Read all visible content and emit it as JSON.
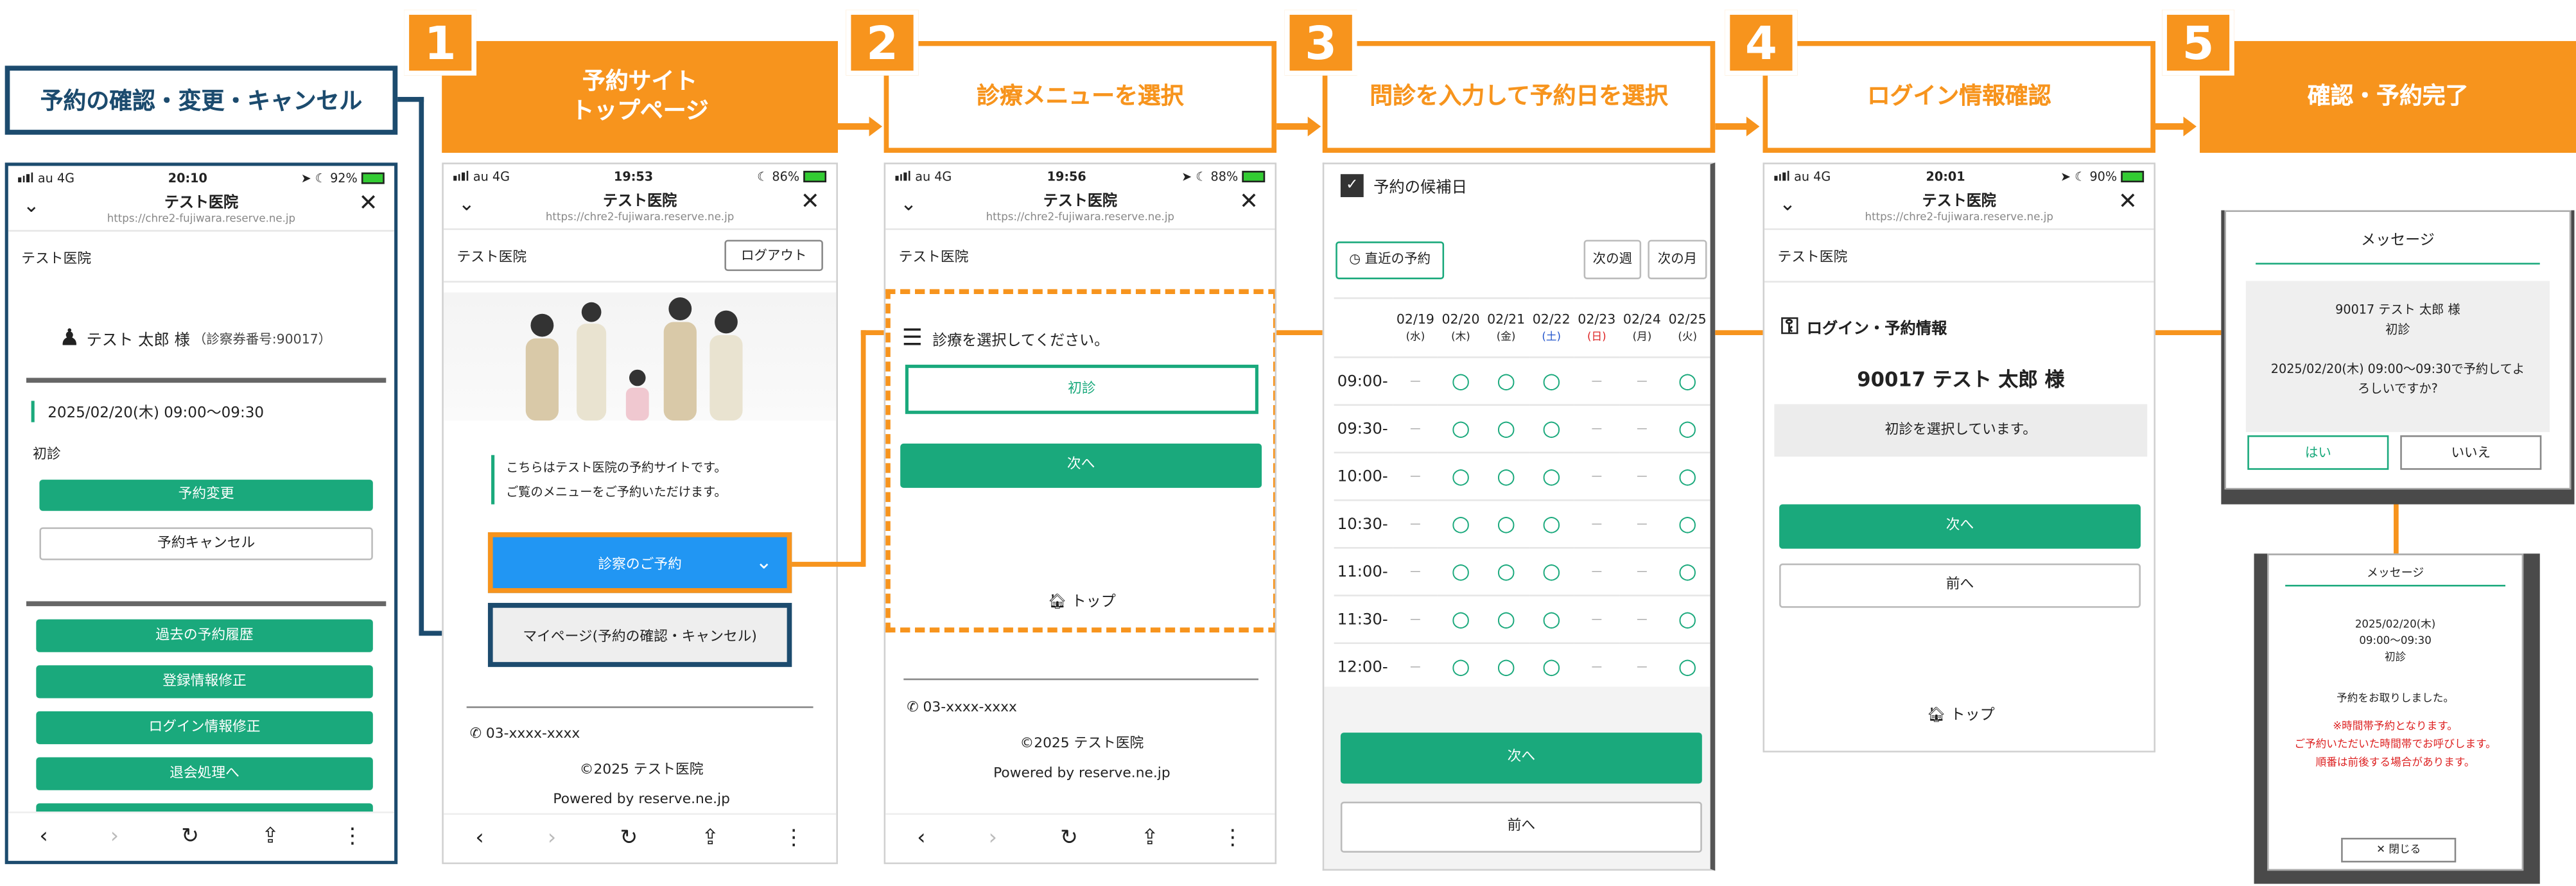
{
  "left_label": "予約の確認・変更・キャンセル",
  "steps": [
    {
      "num": "1",
      "title_line1": "予約サイト",
      "title_line2": "トップページ"
    },
    {
      "num": "2",
      "title": "診療メニューを選択"
    },
    {
      "num": "3",
      "title": "問診を入力して予約日を選択"
    },
    {
      "num": "4",
      "title": "ログイン情報確認"
    },
    {
      "num": "5",
      "title": "確認・予約完了"
    }
  ],
  "common": {
    "carrier": "au  4G",
    "site_title": "テスト医院",
    "url": "https://chre2-fujiwara.reserve.ne.jp",
    "hospital": "テスト医院",
    "phone": "03-xxxx-xxxx",
    "copyright": "©2025 テスト医院",
    "powered": "Powered by reserve.ne.jp",
    "top_link": "トップ"
  },
  "phone0": {
    "time": "20:10",
    "battery": "92%",
    "patient": "テスト 太郎 様",
    "patient_no": "（診察券番号:90017）",
    "datetime": "2025/02/20(木)  09:00〜09:30",
    "menu": "初診",
    "change_btn": "予約変更",
    "cancel_btn": "予約キャンセル",
    "history_btn": "過去の予約履歴",
    "reginfo_btn": "登録情報修正",
    "logininfo_btn": "ログイン情報修正",
    "withdraw_btn": "退会処理へ"
  },
  "phone1": {
    "time": "19:53",
    "battery": "86%",
    "logout": "ログアウト",
    "intro1": "こちらはテスト医院の予約サイトです。",
    "intro2": "ご覧のメニューをご予約いただけます。",
    "reserve_btn": "診察のご予約",
    "mypage_btn": "マイページ(予約の確認・キャンセル)"
  },
  "phone2": {
    "time": "19:56",
    "battery": "88%",
    "prompt": "診療を選択してください。",
    "option": "初診",
    "next": "次へ"
  },
  "phone3": {
    "heading": "予約の候補日",
    "recent_btn": "直近の予約",
    "next_week": "次の週",
    "next_month": "次の月",
    "dates": [
      {
        "d": "02/19",
        "w": "(水)",
        "c": ""
      },
      {
        "d": "02/20",
        "w": "(木)",
        "c": ""
      },
      {
        "d": "02/21",
        "w": "(金)",
        "c": ""
      },
      {
        "d": "02/22",
        "w": "(土)",
        "c": "blue"
      },
      {
        "d": "02/23",
        "w": "(日)",
        "c": "red"
      },
      {
        "d": "02/24",
        "w": "(月)",
        "c": ""
      },
      {
        "d": "02/25",
        "w": "(火)",
        "c": ""
      }
    ],
    "slots": [
      {
        "t": "09:00-",
        "v": [
          "－",
          "○",
          "○",
          "○",
          "－",
          "－",
          "○"
        ]
      },
      {
        "t": "09:30-",
        "v": [
          "－",
          "○",
          "○",
          "○",
          "－",
          "－",
          "○"
        ]
      },
      {
        "t": "10:00-",
        "v": [
          "－",
          "○",
          "○",
          "○",
          "－",
          "－",
          "○"
        ]
      },
      {
        "t": "10:30-",
        "v": [
          "－",
          "○",
          "○",
          "○",
          "－",
          "－",
          "○"
        ]
      },
      {
        "t": "11:00-",
        "v": [
          "－",
          "○",
          "○",
          "○",
          "－",
          "－",
          "○"
        ]
      },
      {
        "t": "11:30-",
        "v": [
          "－",
          "○",
          "○",
          "○",
          "－",
          "－",
          "○"
        ]
      },
      {
        "t": "12:00-",
        "v": [
          "－",
          "○",
          "○",
          "○",
          "－",
          "－",
          "○"
        ]
      }
    ],
    "next": "次へ",
    "prev": "前へ"
  },
  "phone4": {
    "time": "20:01",
    "battery": "90%",
    "login_heading": "ログイン・予約情報",
    "patient_name": "90017 テスト 太郎 様",
    "selected": "初診を選択しています。",
    "next": "次へ",
    "prev": "前へ"
  },
  "dialog1": {
    "title": "メッセージ",
    "line1": "90017 テスト 太郎 様",
    "line2": "初診",
    "line3": "2025/02/20(木) 09:00〜09:30で予約してよ",
    "line4": "ろしいですか?",
    "yes": "はい",
    "no": "いいえ"
  },
  "dialog2": {
    "title": "メッセージ",
    "date": "2025/02/20(木)",
    "time": "09:00〜09:30",
    "menu": "初診",
    "done": "予約をお取りしました。",
    "warn1": "※時間帯予約となります。",
    "warn2": "ご予約いただいた時間帯でお呼びします。",
    "warn3": "順番は前後する場合があります。",
    "close": "✕ 閉じる"
  },
  "colors": {
    "orange": "#f7941d",
    "green": "#1aa97c",
    "navy": "#1c4b6e",
    "blue": "#2196f3"
  }
}
